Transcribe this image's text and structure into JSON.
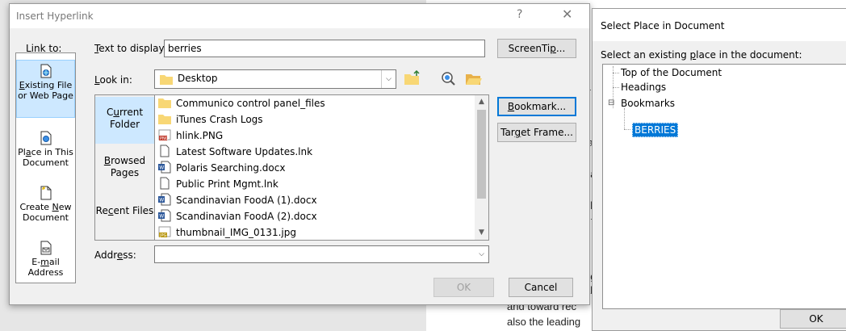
{
  "background_doc": {
    "fragments": [
      "T",
      "fl",
      "ta",
      "b",
      "na",
      "d i",
      "oly",
      "r f",
      "eg",
      "al",
      "and toward rec",
      "also the leading"
    ]
  },
  "insert_hyperlink": {
    "title": "Insert Hyperlink",
    "help": "?",
    "close": "✕",
    "link_to_label": "Link to:",
    "text_to_display_label": "Text to display:",
    "text_to_display_value": "berries",
    "screentip_label": "ScreenTip...",
    "look_in_label": "Look in:",
    "look_in_value": "Desktop",
    "link_to_items": [
      {
        "label": "Existing File or Web Page",
        "selected": true
      },
      {
        "label": "Place in This Document",
        "selected": false
      },
      {
        "label": "Create New Document",
        "selected": false
      },
      {
        "label": "E-mail Address",
        "selected": false
      }
    ],
    "browse_items": [
      {
        "label": "Current Folder",
        "selected": true
      },
      {
        "label": "Browsed Pages",
        "selected": false
      },
      {
        "label": "Recent Files",
        "selected": false
      }
    ],
    "files": [
      {
        "name": "Communico control panel_files",
        "icon": "folder-icon"
      },
      {
        "name": "iTunes Crash Logs",
        "icon": "folder-icon"
      },
      {
        "name": "hlink.PNG",
        "icon": "png-file-icon"
      },
      {
        "name": "Latest Software Updates.lnk",
        "icon": "shortcut-file-icon"
      },
      {
        "name": "Polaris Searching.docx",
        "icon": "word-doc-icon"
      },
      {
        "name": "Public Print Mgmt.lnk",
        "icon": "shortcut-file-icon"
      },
      {
        "name": "Scandinavian FoodA (1).docx",
        "icon": "word-doc-icon"
      },
      {
        "name": "Scandinavian FoodA (2).docx",
        "icon": "word-doc-icon"
      },
      {
        "name": "thumbnail_IMG_0131.jpg",
        "icon": "jpg-file-icon"
      }
    ],
    "bookmark_label": "Bookmark...",
    "target_frame_label": "Target Frame...",
    "address_label": "Address:",
    "address_value": "",
    "ok_label": "OK",
    "cancel_label": "Cancel"
  },
  "select_place": {
    "title": "Select Place in Document",
    "prompt": "Select an existing place in the document:",
    "tree": [
      {
        "label": "Top of the Document",
        "level": 0
      },
      {
        "label": "Headings",
        "level": 0
      },
      {
        "label": "Bookmarks",
        "level": 0,
        "expander": "⊟"
      },
      {
        "label": "BERRIES",
        "level": 1,
        "selected": true
      }
    ],
    "ok_label": "OK"
  },
  "colors": {
    "selection_blue": "#0078d7",
    "link_selected_bg": "#cde8ff",
    "folder_yellow": "#f8d775"
  }
}
